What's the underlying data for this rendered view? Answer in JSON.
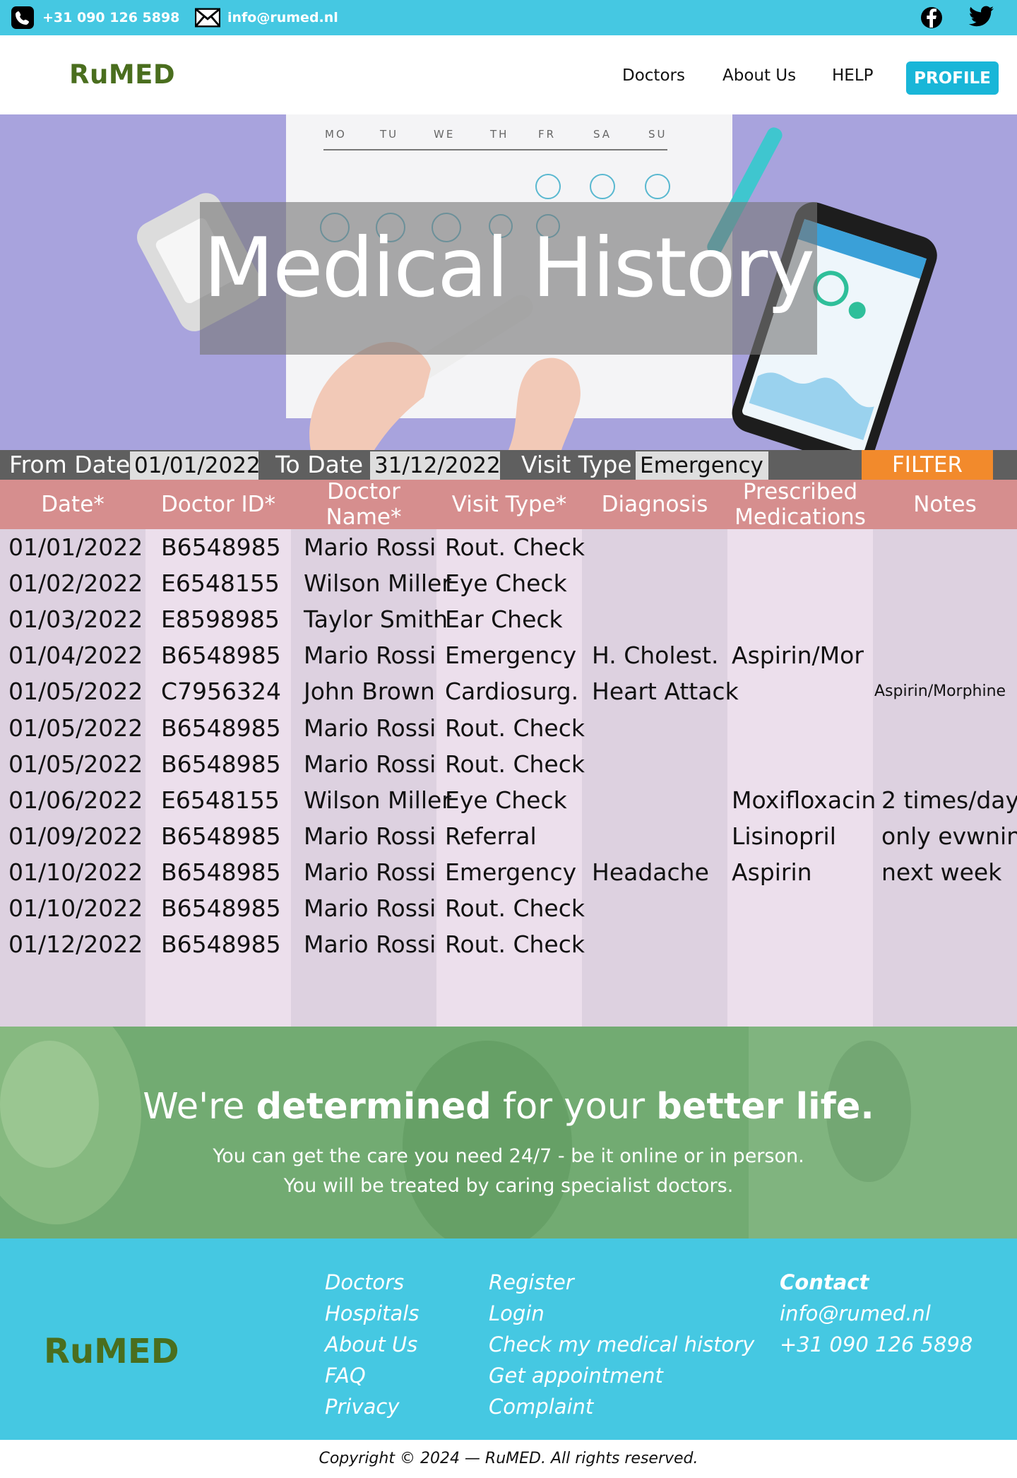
{
  "topbar": {
    "phone": "+31 090 126 5898",
    "email": "info@rumed.nl",
    "icons": [
      "phone-icon",
      "mail-icon",
      "facebook-icon",
      "twitter-icon"
    ]
  },
  "header": {
    "logo": "RuMED",
    "nav": [
      "Doctors",
      "About Us",
      "HELP"
    ],
    "profile": "PROFILE"
  },
  "hero": {
    "title": "Medical History",
    "calendar_days": [
      "MO",
      "TU",
      "WE",
      "TH",
      "FR",
      "SA",
      "SU"
    ]
  },
  "filter": {
    "from_label": "From Date",
    "from_value": "01/01/2022",
    "to_label": "To Date",
    "to_value": "31/12/2022",
    "visit_label": "Visit Type",
    "visit_value": "Emergency",
    "button": "FILTER"
  },
  "table": {
    "headers": [
      "Date*",
      "Doctor ID*",
      "Doctor Name*",
      "Visit Type*",
      "Diagnosis",
      "Prescribed Medications",
      "Notes"
    ],
    "rows": [
      [
        "01/01/2022",
        "B6548985",
        "Mario Rossi",
        "Rout. Check",
        "",
        "",
        ""
      ],
      [
        "01/02/2022",
        "E6548155",
        "Wilson Miller",
        "Eye Check",
        "",
        "",
        ""
      ],
      [
        "01/03/2022",
        "E8598985",
        "Taylor Smith",
        "Ear Check",
        "",
        "",
        ""
      ],
      [
        "01/04/2022",
        "B6548985",
        "Mario Rossi",
        "Emergency",
        "H. Cholest.",
        "Aspirin/Mor",
        ""
      ],
      [
        "01/05/2022",
        "C7956324",
        "John Brown",
        "Cardiosurg.",
        "Heart Attack",
        "",
        "Aspirin/Morphine"
      ],
      [
        "01/05/2022",
        "B6548985",
        "Mario Rossi",
        "Rout. Check",
        "",
        "",
        ""
      ],
      [
        "01/05/2022",
        "B6548985",
        "Mario Rossi",
        "Rout. Check",
        "",
        "",
        ""
      ],
      [
        "01/06/2022",
        "E6548155",
        "Wilson Miller",
        "Eye Check",
        "",
        "Moxifloxacin",
        "2 times/day"
      ],
      [
        "01/09/2022",
        "B6548985",
        "Mario Rossi",
        "Referral",
        "",
        "Lisinopril",
        "only evwnin"
      ],
      [
        "01/10/2022",
        "B6548985",
        "Mario Rossi",
        "Emergency",
        "Headache",
        "Aspirin",
        "next week"
      ],
      [
        "01/10/2022",
        "B6548985",
        "Mario Rossi",
        "Rout. Check",
        "",
        "",
        ""
      ],
      [
        "01/12/2022",
        "B6548985",
        "Mario Rossi",
        "Rout. Check",
        "",
        "",
        ""
      ]
    ]
  },
  "banner": {
    "pre": "We're ",
    "bold1": "determined",
    "mid": " for your ",
    "bold2": "better life.",
    "line1": "You can get the care you need 24/7 - be it online or in person.",
    "line2": "You will be treated by caring specialist doctors."
  },
  "footer": {
    "logo": "RuMED",
    "col1": [
      "Doctors",
      "Hospitals",
      "About Us",
      "FAQ",
      "Privacy"
    ],
    "col2": [
      "Register",
      "Login",
      "Check my medical history",
      "Get appointment",
      "Complaint"
    ],
    "contact_title": "Contact",
    "contact_email": "info@rumed.nl",
    "contact_phone": "+31 090 126 5898",
    "copyright": "Copyright © 2024 — RuMED. All rights reserved."
  },
  "colors": {
    "topbar": "#45c8e2",
    "brand_green": "#4a6e1e",
    "profile_button": "#19b6d8",
    "filter_button": "#f28a2c",
    "table_header": "#d68e8e"
  }
}
